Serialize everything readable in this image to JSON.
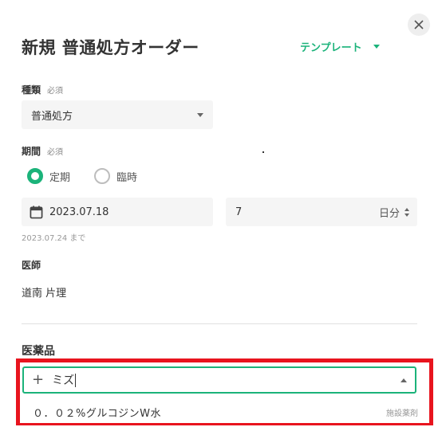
{
  "header": {
    "title": "新規 普通処方オーダー",
    "template_label": "テンプレート"
  },
  "kind": {
    "label": "種類",
    "required": "必須",
    "value": "普通処方"
  },
  "period": {
    "label": "期間",
    "required": "必須",
    "options": [
      {
        "label": "定期",
        "selected": true
      },
      {
        "label": "臨時",
        "selected": false
      }
    ],
    "start_date": "2023.07.18",
    "days": "7",
    "unit": "日分",
    "end_hint": "2023.07.24 まで"
  },
  "doctor": {
    "label": "医師",
    "name": "道南 片理"
  },
  "medicine": {
    "label": "医薬品",
    "search_value": "ミズ",
    "results": [
      {
        "name": "０．０２%グルコジンW水",
        "tag": "施設薬剤"
      }
    ]
  },
  "colors": {
    "accent": "#1bb37a",
    "highlight": "#e8141e"
  },
  "icons": [
    "close-icon",
    "dropdown-caret-icon",
    "calendar-icon",
    "spinner-icon",
    "plus-icon",
    "collapse-caret-icon"
  ]
}
